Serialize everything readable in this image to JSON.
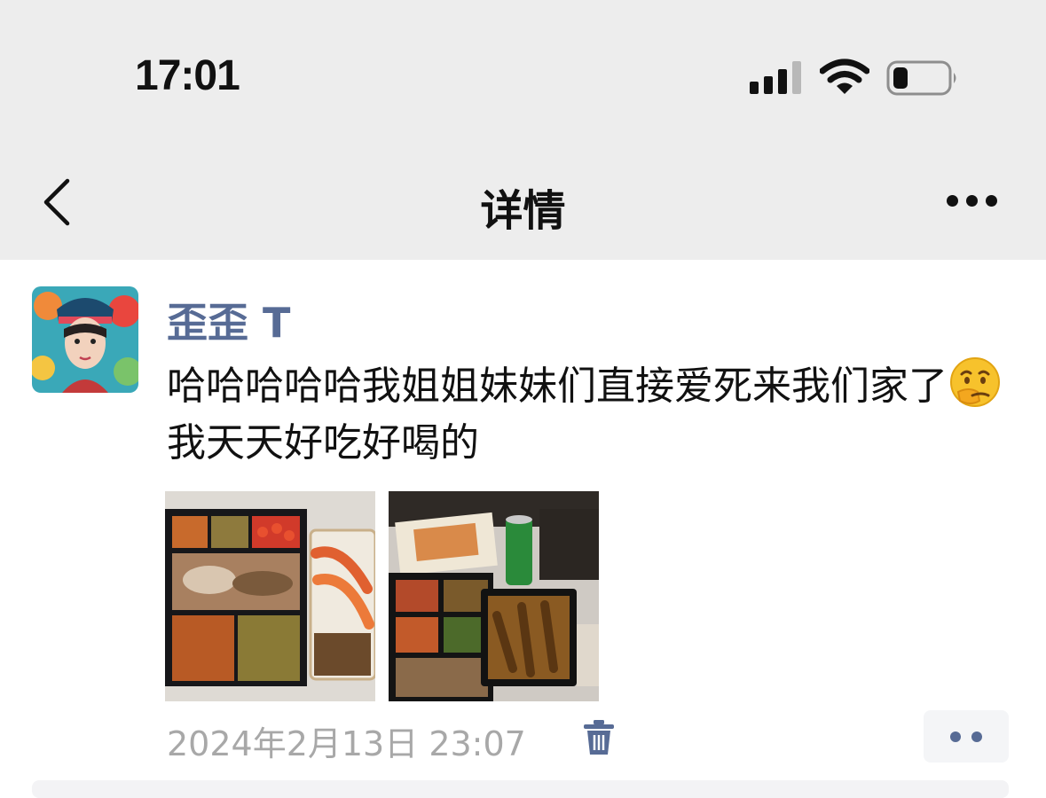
{
  "status_bar": {
    "time": "17:01",
    "signal_icon": "cellular-signal-icon",
    "wifi_icon": "wifi-icon",
    "battery_icon": "battery-low-icon"
  },
  "nav": {
    "title": "详情",
    "back_icon": "chevron-left-icon",
    "more_icon": "more-horizontal-icon"
  },
  "post": {
    "author": "歪歪 T",
    "text_part1": "哈哈哈哈哈我姐姐妹妹们直接爱死来我们家了",
    "emoji": "thinking-face-emoji",
    "text_part2": "我天天好吃好喝的",
    "images": [
      "bento-seafood-photo",
      "bento-table-photo"
    ],
    "timestamp": "2024年2月13日 23:07",
    "delete_icon": "trash-icon",
    "action_icon": "two-dots-icon"
  },
  "colors": {
    "header_bg": "#ededed",
    "link_blue": "#576b95",
    "timestamp_gray": "#a8a8a8"
  }
}
